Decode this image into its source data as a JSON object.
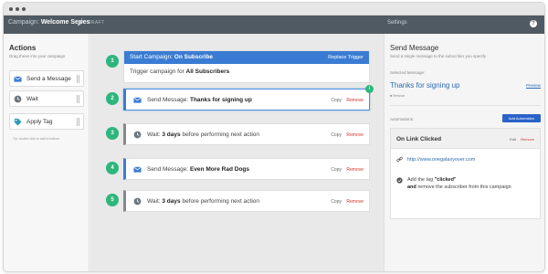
{
  "topbar": {
    "campaign_prefix": "Campaign:",
    "campaign_name": "Welcome Series",
    "status": "DRAFT",
    "settings_label": "Settings",
    "help_label": "?"
  },
  "actions_panel": {
    "title": "Actions",
    "subtitle": "Drag these into your campaign",
    "items": [
      {
        "label": "Send a Message",
        "icon": "envelope-icon"
      },
      {
        "label": "Wait",
        "icon": "clock-icon"
      },
      {
        "label": "Apply Tag",
        "icon": "tag-icon"
      }
    ],
    "tip": "Tip: double click to add to bottom"
  },
  "trigger": {
    "number": "1",
    "prefix": "Start Campaign:",
    "name": "On Subscribe",
    "replace_label": "Replace Trigger",
    "body_prefix": "Trigger campaign for",
    "body_target": "All Subscribers"
  },
  "steps": [
    {
      "number": "2",
      "type": "message",
      "prefix": "Send Message:",
      "bold": "Thanks for signing up",
      "suffix": "",
      "copy": "Copy",
      "remove": "Remove",
      "selected": true,
      "badge": "i"
    },
    {
      "number": "3",
      "type": "wait",
      "prefix": "Wait:",
      "bold": "3 days",
      "suffix": "before performing next action",
      "copy": "Copy",
      "remove": "Remove",
      "selected": false
    },
    {
      "number": "4",
      "type": "message",
      "prefix": "Send Message:",
      "bold": "Even More Rad Dogs",
      "suffix": "",
      "copy": "Copy",
      "remove": "Remove",
      "selected": false
    },
    {
      "number": "5",
      "type": "wait",
      "prefix": "Wait:",
      "bold": "3 days",
      "suffix": "before performing next action",
      "copy": "Copy",
      "remove": "Remove",
      "selected": false
    }
  ],
  "settings_panel": {
    "title": "Send Message",
    "subtitle": "Send a single message to the subscriber you specify",
    "selected_label": "Selected Message:",
    "selected_value": "Thanks for signing up",
    "preview_label": "Preview",
    "remove_label": "Remove",
    "automations_label": "Automations:",
    "add_automation_label": "Add Automation",
    "automation": {
      "title": "On Link Clicked",
      "edit_label": "Edit",
      "remove_label": "Remove",
      "link": "http://www.onegalaxyover.com",
      "tag_prefix": "Add the tag",
      "tag_name": "\"clicked\"",
      "tag_line2_bold": "and",
      "tag_line2_rest": "remove the subscriber from this campaign"
    }
  },
  "colors": {
    "topbar": "#505a63",
    "accent_blue": "#3a7cd3",
    "step_green": "#2eb67d",
    "remove_red": "#d0342c"
  }
}
